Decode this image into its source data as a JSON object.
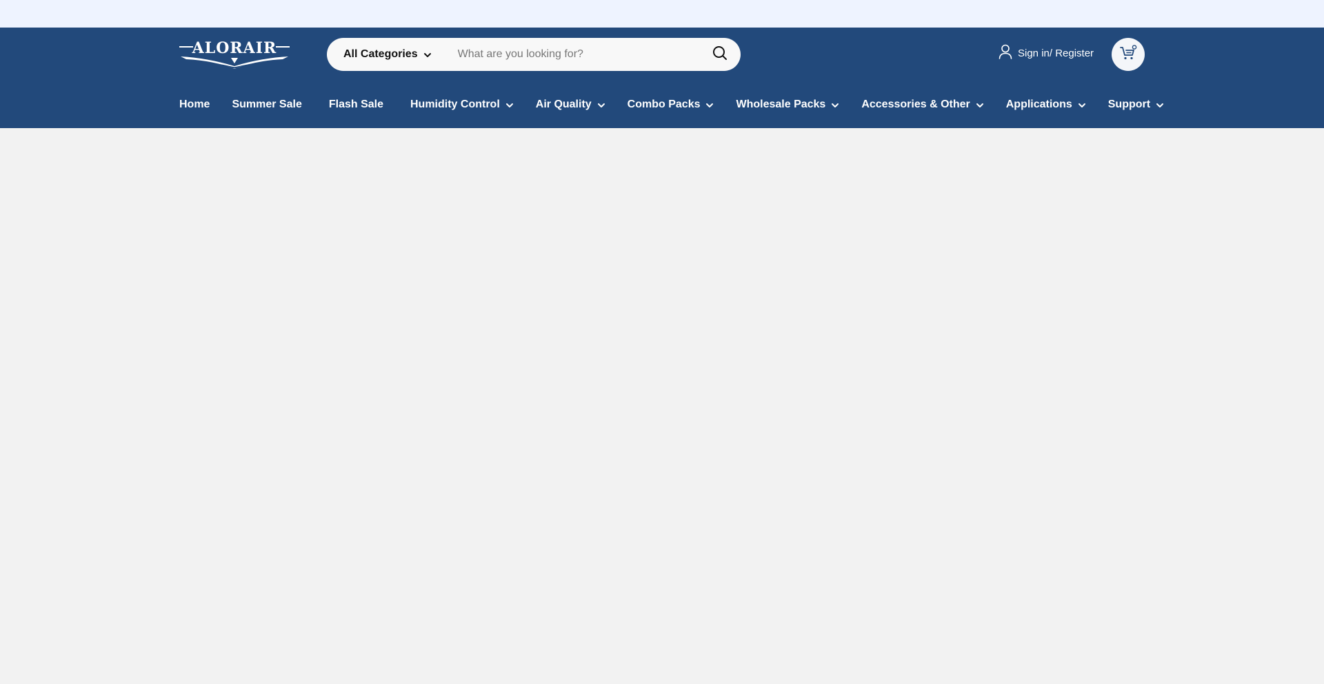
{
  "header": {
    "logo_text": "ALORAIR",
    "search": {
      "category_label": "All Categories",
      "placeholder": "What are you looking for?",
      "value": ""
    },
    "account_label": "Sign in/ Register"
  },
  "nav": {
    "items": [
      {
        "label": "Home",
        "has_dropdown": false
      },
      {
        "label": "Summer Sale",
        "has_dropdown": false
      },
      {
        "label": "Flash Sale",
        "has_dropdown": false
      },
      {
        "label": "Humidity Control",
        "has_dropdown": true
      },
      {
        "label": "Air Quality",
        "has_dropdown": true
      },
      {
        "label": "Combo Packs",
        "has_dropdown": true
      },
      {
        "label": "Wholesale Packs",
        "has_dropdown": true
      },
      {
        "label": "Accessories & Other",
        "has_dropdown": true
      },
      {
        "label": "Applications",
        "has_dropdown": true
      },
      {
        "label": "Support",
        "has_dropdown": true
      }
    ]
  },
  "colors": {
    "topbar": "#eef3ff",
    "header": "#22497b",
    "page": "#f2f2f2",
    "search_bg": "#f8f8f8"
  },
  "icons": {
    "category_chevron": "chevron-down-icon",
    "search": "search-icon",
    "account": "user-icon",
    "cart": "cart-icon"
  }
}
